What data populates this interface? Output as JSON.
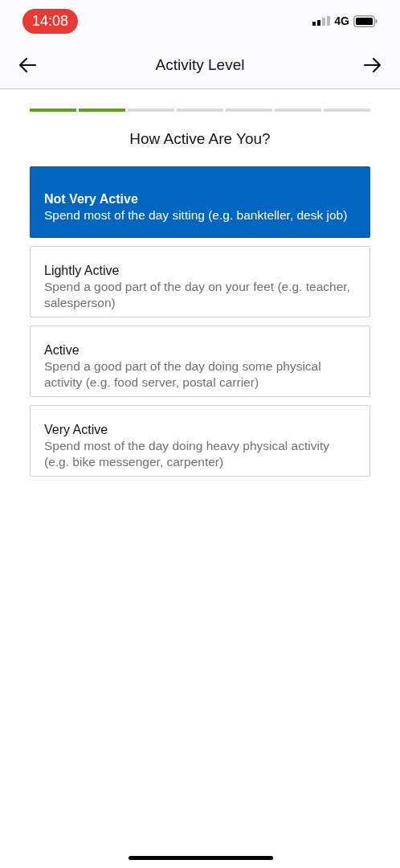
{
  "status_bar": {
    "time": "14:08",
    "network": "4G"
  },
  "header": {
    "title": "Activity Level"
  },
  "progress": {
    "steps": [
      {
        "completed": true
      },
      {
        "completed": true
      },
      {
        "completed": false
      },
      {
        "completed": false
      },
      {
        "completed": false
      },
      {
        "completed": false
      },
      {
        "completed": false
      }
    ]
  },
  "question": "How Active Are You?",
  "options": [
    {
      "title": "Not Very Active",
      "description": "Spend most of the day sitting (e.g. bankteller, desk job)",
      "selected": true
    },
    {
      "title": "Lightly Active",
      "description": "Spend a good part of the day on your feet (e.g. teacher, salesperson)",
      "selected": false
    },
    {
      "title": "Active",
      "description": "Spend a good part of the day doing some physical activity (e.g. food server, postal carrier)",
      "selected": false
    },
    {
      "title": "Very Active",
      "description": "Spend most of the day doing heavy physical activity (e.g. bike messenger, carpenter)",
      "selected": false
    }
  ]
}
